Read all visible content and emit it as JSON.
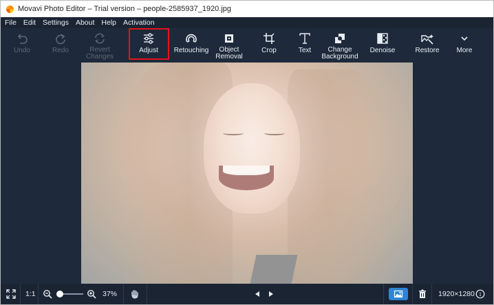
{
  "titlebar": {
    "title": "Movavi Photo Editor – Trial version – people-2585937_1920.jpg"
  },
  "menu": {
    "items": [
      "File",
      "Edit",
      "Settings",
      "About",
      "Help",
      "Activation"
    ]
  },
  "toolbar": {
    "items": [
      {
        "label": "Undo",
        "icon": "undo-icon",
        "enabled": false
      },
      {
        "label": "Redo",
        "icon": "redo-icon",
        "enabled": false
      },
      {
        "label": "Revert\nChanges",
        "icon": "revert-icon",
        "enabled": false
      },
      {
        "label": "Adjust",
        "icon": "sliders-icon",
        "enabled": true,
        "highlighted": true
      },
      {
        "label": "Retouching",
        "icon": "retouch-icon",
        "enabled": true
      },
      {
        "label": "Object\nRemoval",
        "icon": "eraser-icon",
        "enabled": true
      },
      {
        "label": "Crop",
        "icon": "crop-icon",
        "enabled": true
      },
      {
        "label": "Text",
        "icon": "text-icon",
        "enabled": true
      },
      {
        "label": "Change\nBackground",
        "icon": "background-icon",
        "enabled": true
      },
      {
        "label": "Denoise",
        "icon": "denoise-icon",
        "enabled": true
      },
      {
        "label": "Restore",
        "icon": "restore-icon",
        "enabled": true
      },
      {
        "label": "More",
        "icon": "chevron-down-icon",
        "enabled": true
      }
    ]
  },
  "statusbar": {
    "ratio_label": "1:1",
    "zoom_percent": "37%",
    "zoom_level": 0.37,
    "image_size": "1920×1280",
    "info_glyph": "i"
  },
  "colors": {
    "background": "#1e2a3b",
    "statusbar": "#1b2433",
    "highlight": "#e3131b",
    "accent": "#2e84d6",
    "disabled_text": "#5d6878"
  }
}
